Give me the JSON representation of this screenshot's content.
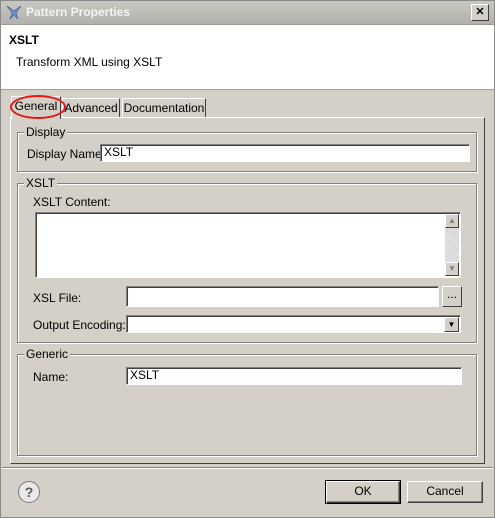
{
  "window": {
    "title": "Pattern Properties",
    "close_glyph": "✕"
  },
  "header": {
    "title": "XSLT",
    "description": "Transform XML using XSLT"
  },
  "tabs": [
    {
      "label": "General",
      "active": true
    },
    {
      "label": "Advanced",
      "active": false
    },
    {
      "label": "Documentation",
      "active": false
    }
  ],
  "display_group": {
    "legend": "Display",
    "name_label": "Display Name:",
    "name_value": "XSLT"
  },
  "xslt_group": {
    "legend": "XSLT",
    "content_label": "XSLT Content:",
    "content_value": "",
    "xsl_file_label": "XSL File:",
    "xsl_file_value": "",
    "browse_label": "...",
    "encoding_label": "Output Encoding:",
    "encoding_value": ""
  },
  "generic_group": {
    "legend": "Generic",
    "name_label": "Name:",
    "name_value": "XSLT"
  },
  "footer": {
    "help_glyph": "?",
    "ok_label": "OK",
    "cancel_label": "Cancel"
  },
  "colors": {
    "highlight_circle": "#e01818",
    "dialog_bg": "#d4d0c8"
  }
}
